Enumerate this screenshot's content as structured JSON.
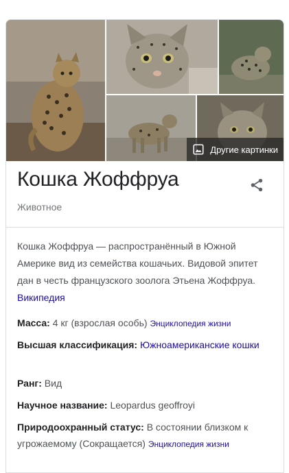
{
  "gallery": {
    "more_images_label": "Другие картинки"
  },
  "entity": {
    "title": "Кошка Жоффруа",
    "subtitle": "Животное"
  },
  "description": {
    "text": "Кошка Жоффруа — распространённый в Южной Америке вид из семейства кошачьих. Видовой эпитет дан в честь французского зоолога Этьена Жоффруа. ",
    "source": "Википедия"
  },
  "facts": [
    {
      "label": "Масса:",
      "value": "4 кг (взрослая особь)",
      "source": "Энциклопедия жизни"
    },
    {
      "label": "Высшая классификация:",
      "value": "Южноамериканские кошки"
    },
    {
      "label": "Ранг:",
      "value": "Вид"
    },
    {
      "label": "Научное название:",
      "value": "Leopardus geoffroyi"
    },
    {
      "label": "Природоохранный статус:",
      "value": "В состоянии близком к угрожаемому (Сокращается)",
      "source": "Энциклопедия жизни"
    }
  ],
  "icons": {
    "share": "share-icon",
    "images": "image-icon"
  },
  "colors": {
    "link": "#1a0dab",
    "text": "#4d5156",
    "title": "#202124",
    "muted": "#70757a",
    "border": "#dadce0"
  }
}
